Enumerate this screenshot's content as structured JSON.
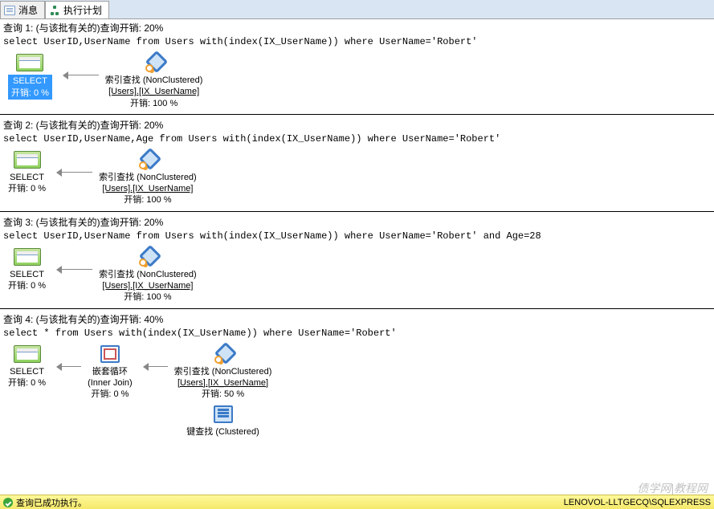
{
  "tabs": {
    "messages": "消息",
    "plan": "执行计划"
  },
  "queries": [
    {
      "title": "查询 1: (与该批有关的)查询开销: 20%",
      "sql": "select UserID,UserName from Users with(index(IX_UserName)) where UserName='Robert'",
      "select_label": "SELECT",
      "select_cost": "开销: 0 %",
      "seek_label": "索引查找 (NonClustered)",
      "seek_detail": "[Users].[IX_UserName]",
      "seek_cost": "开销: 100 %"
    },
    {
      "title": "查询 2: (与该批有关的)查询开销: 20%",
      "sql": "select UserID,UserName,Age from Users with(index(IX_UserName)) where UserName='Robert'",
      "select_label": "SELECT",
      "select_cost": "开销: 0 %",
      "seek_label": "索引查找 (NonClustered)",
      "seek_detail": "[Users].[IX_UserName]",
      "seek_cost": "开销: 100 %"
    },
    {
      "title": "查询 3: (与该批有关的)查询开销: 20%",
      "sql": "select UserID,UserName from Users with(index(IX_UserName)) where UserName='Robert' and Age=28",
      "select_label": "SELECT",
      "select_cost": "开销: 0 %",
      "seek_label": "索引查找 (NonClustered)",
      "seek_detail": "[Users].[IX_UserName]",
      "seek_cost": "开销: 100 %"
    },
    {
      "title": "查询 4: (与该批有关的)查询开销: 40%",
      "sql": "select * from Users with(index(IX_UserName)) where UserName='Robert'",
      "select_label": "SELECT",
      "select_cost": "开销: 0 %",
      "loop_label": "嵌套循环",
      "loop_detail": "(Inner Join)",
      "loop_cost": "开销: 0 %",
      "seek_label": "索引查找 (NonClustered)",
      "seek_detail": "[Users].[IX_UserName]",
      "seek_cost": "开销: 50 %",
      "key_label": "键查找 (Clustered)"
    }
  ],
  "status": {
    "ok_text": "查询已成功执行。",
    "server": "LENOVOL-LLTGECQ\\SQLEXPRESS"
  },
  "watermark": "债学网|教程网"
}
